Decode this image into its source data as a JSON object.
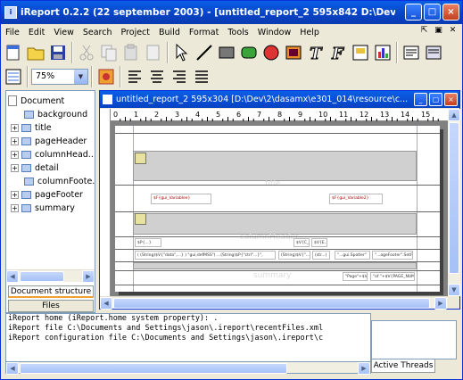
{
  "app": {
    "title": "iReport 0.2.2 (22 september 2003) - [untitled_report_2 595x842 D:\\Dev\\2\\dasamx\\e301_0..."
  },
  "window_buttons": [
    "minimize",
    "maximize",
    "close"
  ],
  "menu": [
    "File",
    "Edit",
    "View",
    "Search",
    "Project",
    "Build",
    "Format",
    "Tools",
    "Window",
    "Help"
  ],
  "toolbar1": [
    "new-icon",
    "open-icon",
    "save-icon",
    "cut-icon",
    "copy-icon",
    "paste-icon",
    "undo-icon",
    "pointer-icon",
    "line-icon",
    "rectangle-icon",
    "rounded-rectangle-icon",
    "ellipse-icon",
    "image-icon",
    "static-text-icon",
    "text-field-icon",
    "subreport-icon",
    "chart-icon",
    "report-properties-icon",
    "compile-icon"
  ],
  "toolbar2": {
    "zoom_value": "75%",
    "icons": [
      "fonts-icon",
      "align-left-icon",
      "align-center-icon",
      "align-right-icon",
      "align-justify-icon"
    ]
  },
  "tree": {
    "items": [
      {
        "label": "Document",
        "type": "doc",
        "level": 0,
        "expander": ""
      },
      {
        "label": "background",
        "type": "folder",
        "level": 1,
        "expander": ""
      },
      {
        "label": "title",
        "type": "folder",
        "level": 1,
        "expander": "+"
      },
      {
        "label": "pageHeader",
        "type": "folder",
        "level": 1,
        "expander": "+"
      },
      {
        "label": "columnHead...",
        "type": "folder",
        "level": 1,
        "expander": "+"
      },
      {
        "label": "detail",
        "type": "folder",
        "level": 1,
        "expander": "+"
      },
      {
        "label": "columnFoote...",
        "type": "folder",
        "level": 1,
        "expander": ""
      },
      {
        "label": "pageFooter",
        "type": "folder",
        "level": 1,
        "expander": "+"
      },
      {
        "label": "summary",
        "type": "folder",
        "level": 1,
        "expander": "+"
      }
    ]
  },
  "left_tabs": {
    "structure": "Document structure",
    "files": "Files"
  },
  "doc_window": {
    "title": "untitled_report_2 595x304 [D:\\Dev\\2\\dasamx\\e301_014\\resource\\c...",
    "ruler_numbers": [
      "0",
      "1",
      "2",
      "3",
      "4",
      "5",
      "6",
      "7",
      "8",
      "9",
      "10",
      "11",
      "12",
      "13",
      "14",
      "15"
    ]
  },
  "report": {
    "field1": "$F{gui_Variablee}",
    "field2": "$F{gui_Variable2}",
    "field3": "$P{...}",
    "field4": "$V{C_...}",
    "field5": "$V{E...}",
    "expr1": "( (String)$V{\"data\",...} ) \"gui,defMSS\"( ...(String)$P{\"ctrl\"...}\",",
    "expr2": "(String)$V{\"...\"}",
    "expr3": "(str...)",
    "expr4": "\"...gui.Spotler\"",
    "expr5": "\"...ageFooter\".SetField\"V{...}",
    "page_label": "\"Page\"+$V{...",
    "page_expr": "\"of \"+$V{PAGE_NUMBER}+\"\"",
    "title_wm": "title",
    "col_wm": "columnHeader",
    "summary_wm": "summary"
  },
  "console": {
    "lines": [
      "iReport home (iReport.home system property): .",
      "iReport file C:\\Documents and Settings\\jason\\.ireport\\recentFiles.xml",
      "iReport configuration file C:\\Documents and Settings\\jason\\.ireport\\c"
    ]
  },
  "threads_tab": "Active Threads"
}
